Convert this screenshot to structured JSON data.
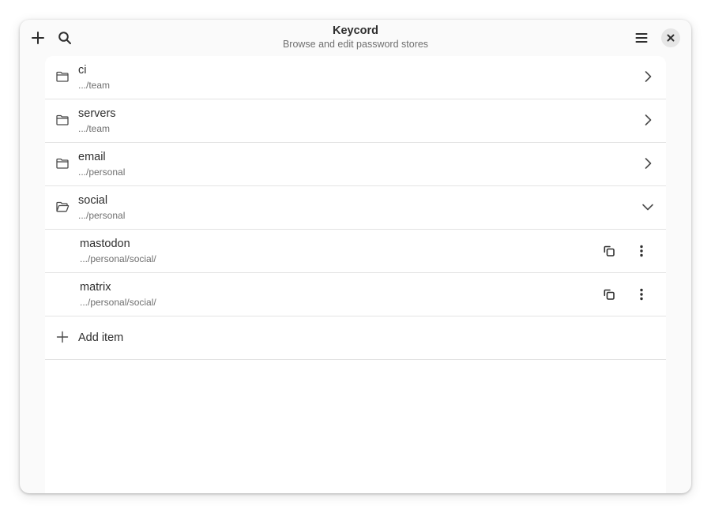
{
  "window": {
    "title": "Keycord",
    "subtitle": "Browse and edit password stores"
  },
  "header": {
    "left_buttons": [
      "add-icon",
      "search-icon"
    ],
    "right_buttons": [
      "menu-icon",
      "close-icon"
    ]
  },
  "folders": [
    {
      "label": "ci",
      "path": ".../team",
      "icon": "folder-icon",
      "expanded": false
    },
    {
      "label": "servers",
      "path": ".../team",
      "icon": "folder-icon",
      "expanded": false
    },
    {
      "label": "email",
      "path": ".../personal",
      "icon": "folder-icon",
      "expanded": false
    },
    {
      "label": "social",
      "path": ".../personal",
      "icon": "folder-open-icon",
      "expanded": true
    }
  ],
  "items": [
    {
      "label": "mastodon",
      "path": ".../personal/social/"
    },
    {
      "label": "matrix",
      "path": ".../personal/social/"
    }
  ],
  "add_item": {
    "label": "Add item"
  },
  "colors": {
    "window_bg": "#fafafa",
    "content_bg": "#ffffff",
    "text": "#2e2e2e",
    "muted_text": "#6f6f6f",
    "divider": "#e3e3e3"
  }
}
